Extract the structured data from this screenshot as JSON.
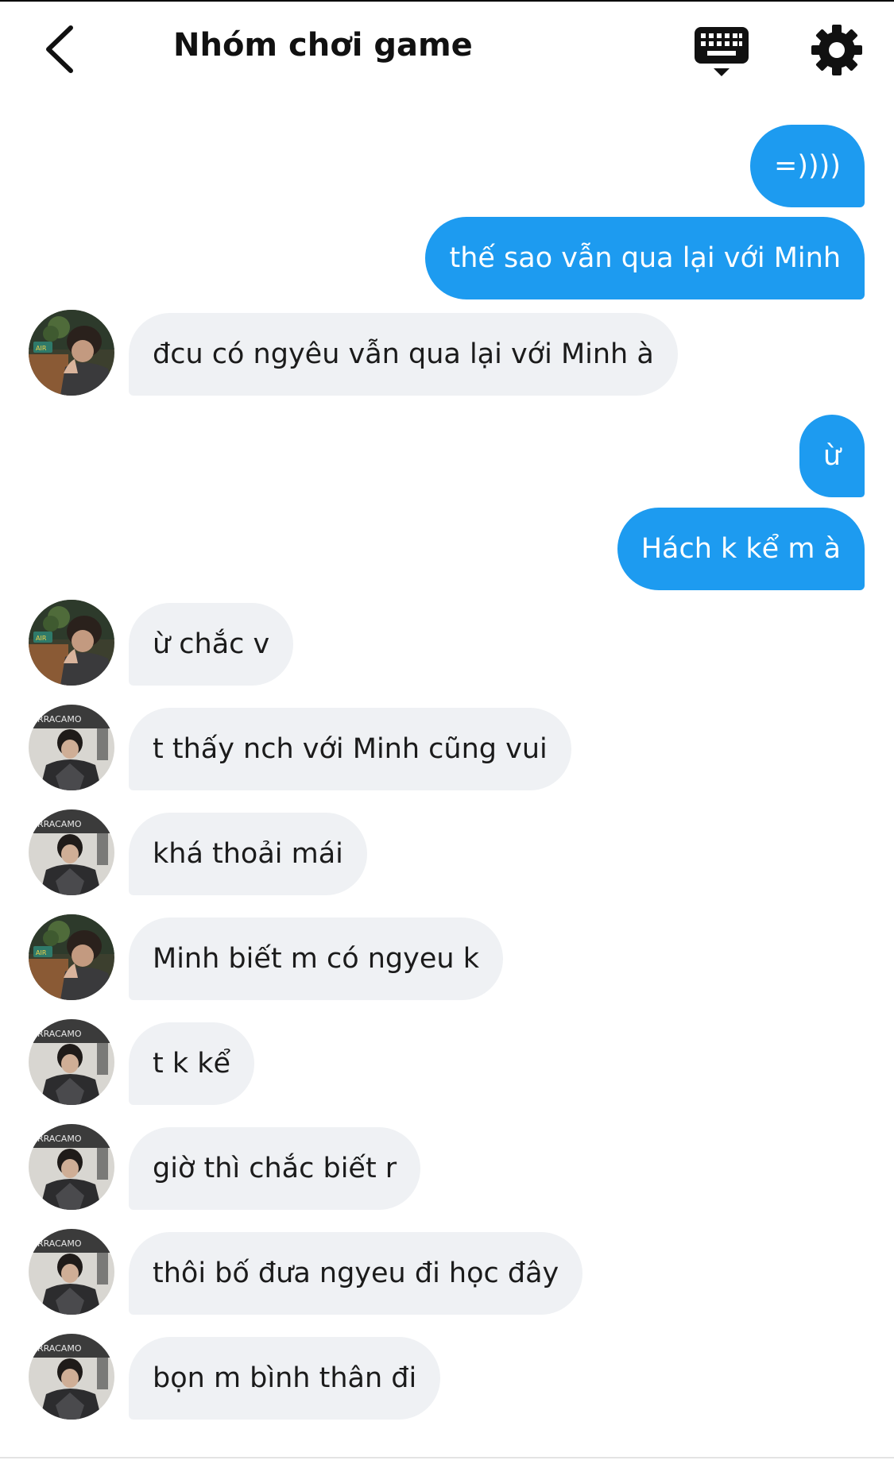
{
  "header": {
    "title": "Nhóm chơi game",
    "back_icon": "chevron-left-icon",
    "keyboard_icon": "keyboard-icon",
    "settings_icon": "gear-icon"
  },
  "colors": {
    "outgoing_bubble": "#1d9bf0",
    "incoming_bubble": "#eff1f4"
  },
  "messages": [
    {
      "direction": "out",
      "text": "=))))"
    },
    {
      "direction": "out",
      "text": "thế sao vẫn qua lại với Minh"
    },
    {
      "direction": "in",
      "sender_avatar": "avatar-a",
      "text": "đcu có ngyêu vẫn qua lại với Minh à"
    },
    {
      "direction": "out",
      "text": "ừ"
    },
    {
      "direction": "out",
      "text": "Hách k kể m à"
    },
    {
      "direction": "in",
      "sender_avatar": "avatar-a",
      "text": "ừ chắc v"
    },
    {
      "direction": "in",
      "sender_avatar": "avatar-b",
      "text": "t thấy nch với Minh cũng vui"
    },
    {
      "direction": "in",
      "sender_avatar": "avatar-b",
      "text": "khá thoải mái"
    },
    {
      "direction": "in",
      "sender_avatar": "avatar-a",
      "text": "Minh biết m có ngyeu k"
    },
    {
      "direction": "in",
      "sender_avatar": "avatar-b",
      "text": "t k kể"
    },
    {
      "direction": "in",
      "sender_avatar": "avatar-b",
      "text": "giờ thì chắc biết r"
    },
    {
      "direction": "in",
      "sender_avatar": "avatar-b",
      "text": "thôi bố đưa ngyeu đi học đây"
    },
    {
      "direction": "in",
      "sender_avatar": "avatar-b",
      "text": "bọn m bình thân đi"
    }
  ]
}
